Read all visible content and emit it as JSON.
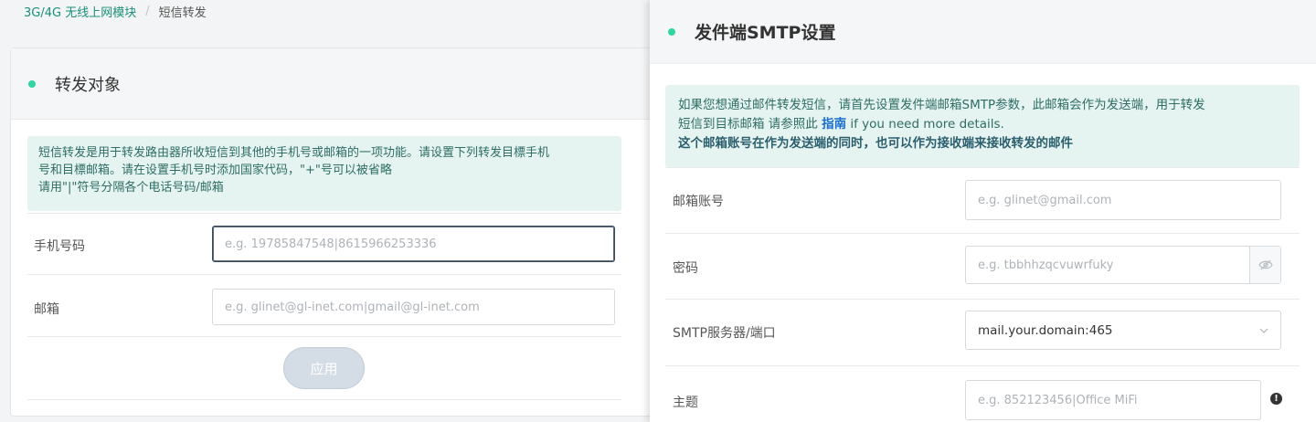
{
  "breadcrumb": {
    "parent": "3G/4G 无线上网模块",
    "separator": "/",
    "current": "短信转发"
  },
  "forward_target": {
    "title": "转发对象",
    "notice": [
      "短信转发是用于转发路由器所收短信到其他的手机号或邮箱的一项功能。请设置下列转发目標手机",
      "号和目標邮箱。请在设置手机号时添加国家代码，\"+\"号可以被省略",
      "请用\"|\"符号分隔各个电话号码/邮箱"
    ],
    "phone_label": "手机号码",
    "phone_placeholder": "e.g. 19785847548|8615966253336",
    "email_label": "邮箱",
    "email_placeholder": "e.g. glinet@gl-inet.com|gmail@gl-inet.com",
    "apply_label": "应用"
  },
  "smtp": {
    "title": "发件端SMTP设置",
    "notice_line1": "如果您想通过邮件转发短信，请首先设置发件端邮箱SMTP参数，此邮箱会作为发送端，用于转发",
    "notice_line2_before": "短信到目标邮箱 请参照此 ",
    "notice_link": "指南",
    "notice_line2_after": " if you need more details.",
    "notice_bold": "这个邮箱账号在作为发送端的同时，也可以作为接收端来接收转发的邮件",
    "account_label": "邮箱账号",
    "account_placeholder": "e.g. glinet@gmail.com",
    "password_label": "密码",
    "password_placeholder": "e.g. tbbhhzqcvuwrfuky",
    "server_label": "SMTP服务器/端口",
    "server_value": "mail.your.domain:465",
    "subject_label": "主题",
    "subject_placeholder": "e.g. 852123456|Office MiFi"
  },
  "icons": {
    "status_dot": "status-dot",
    "eye": "eye-slash-icon",
    "dropdown": "chevron-down-icon",
    "info": "exclamation-circle-icon"
  },
  "colors": {
    "accent": "#2fd6a0",
    "link": "#1a8f7a",
    "notice_bg": "#e5f3f1",
    "button_disabled": "#d4dde5"
  }
}
